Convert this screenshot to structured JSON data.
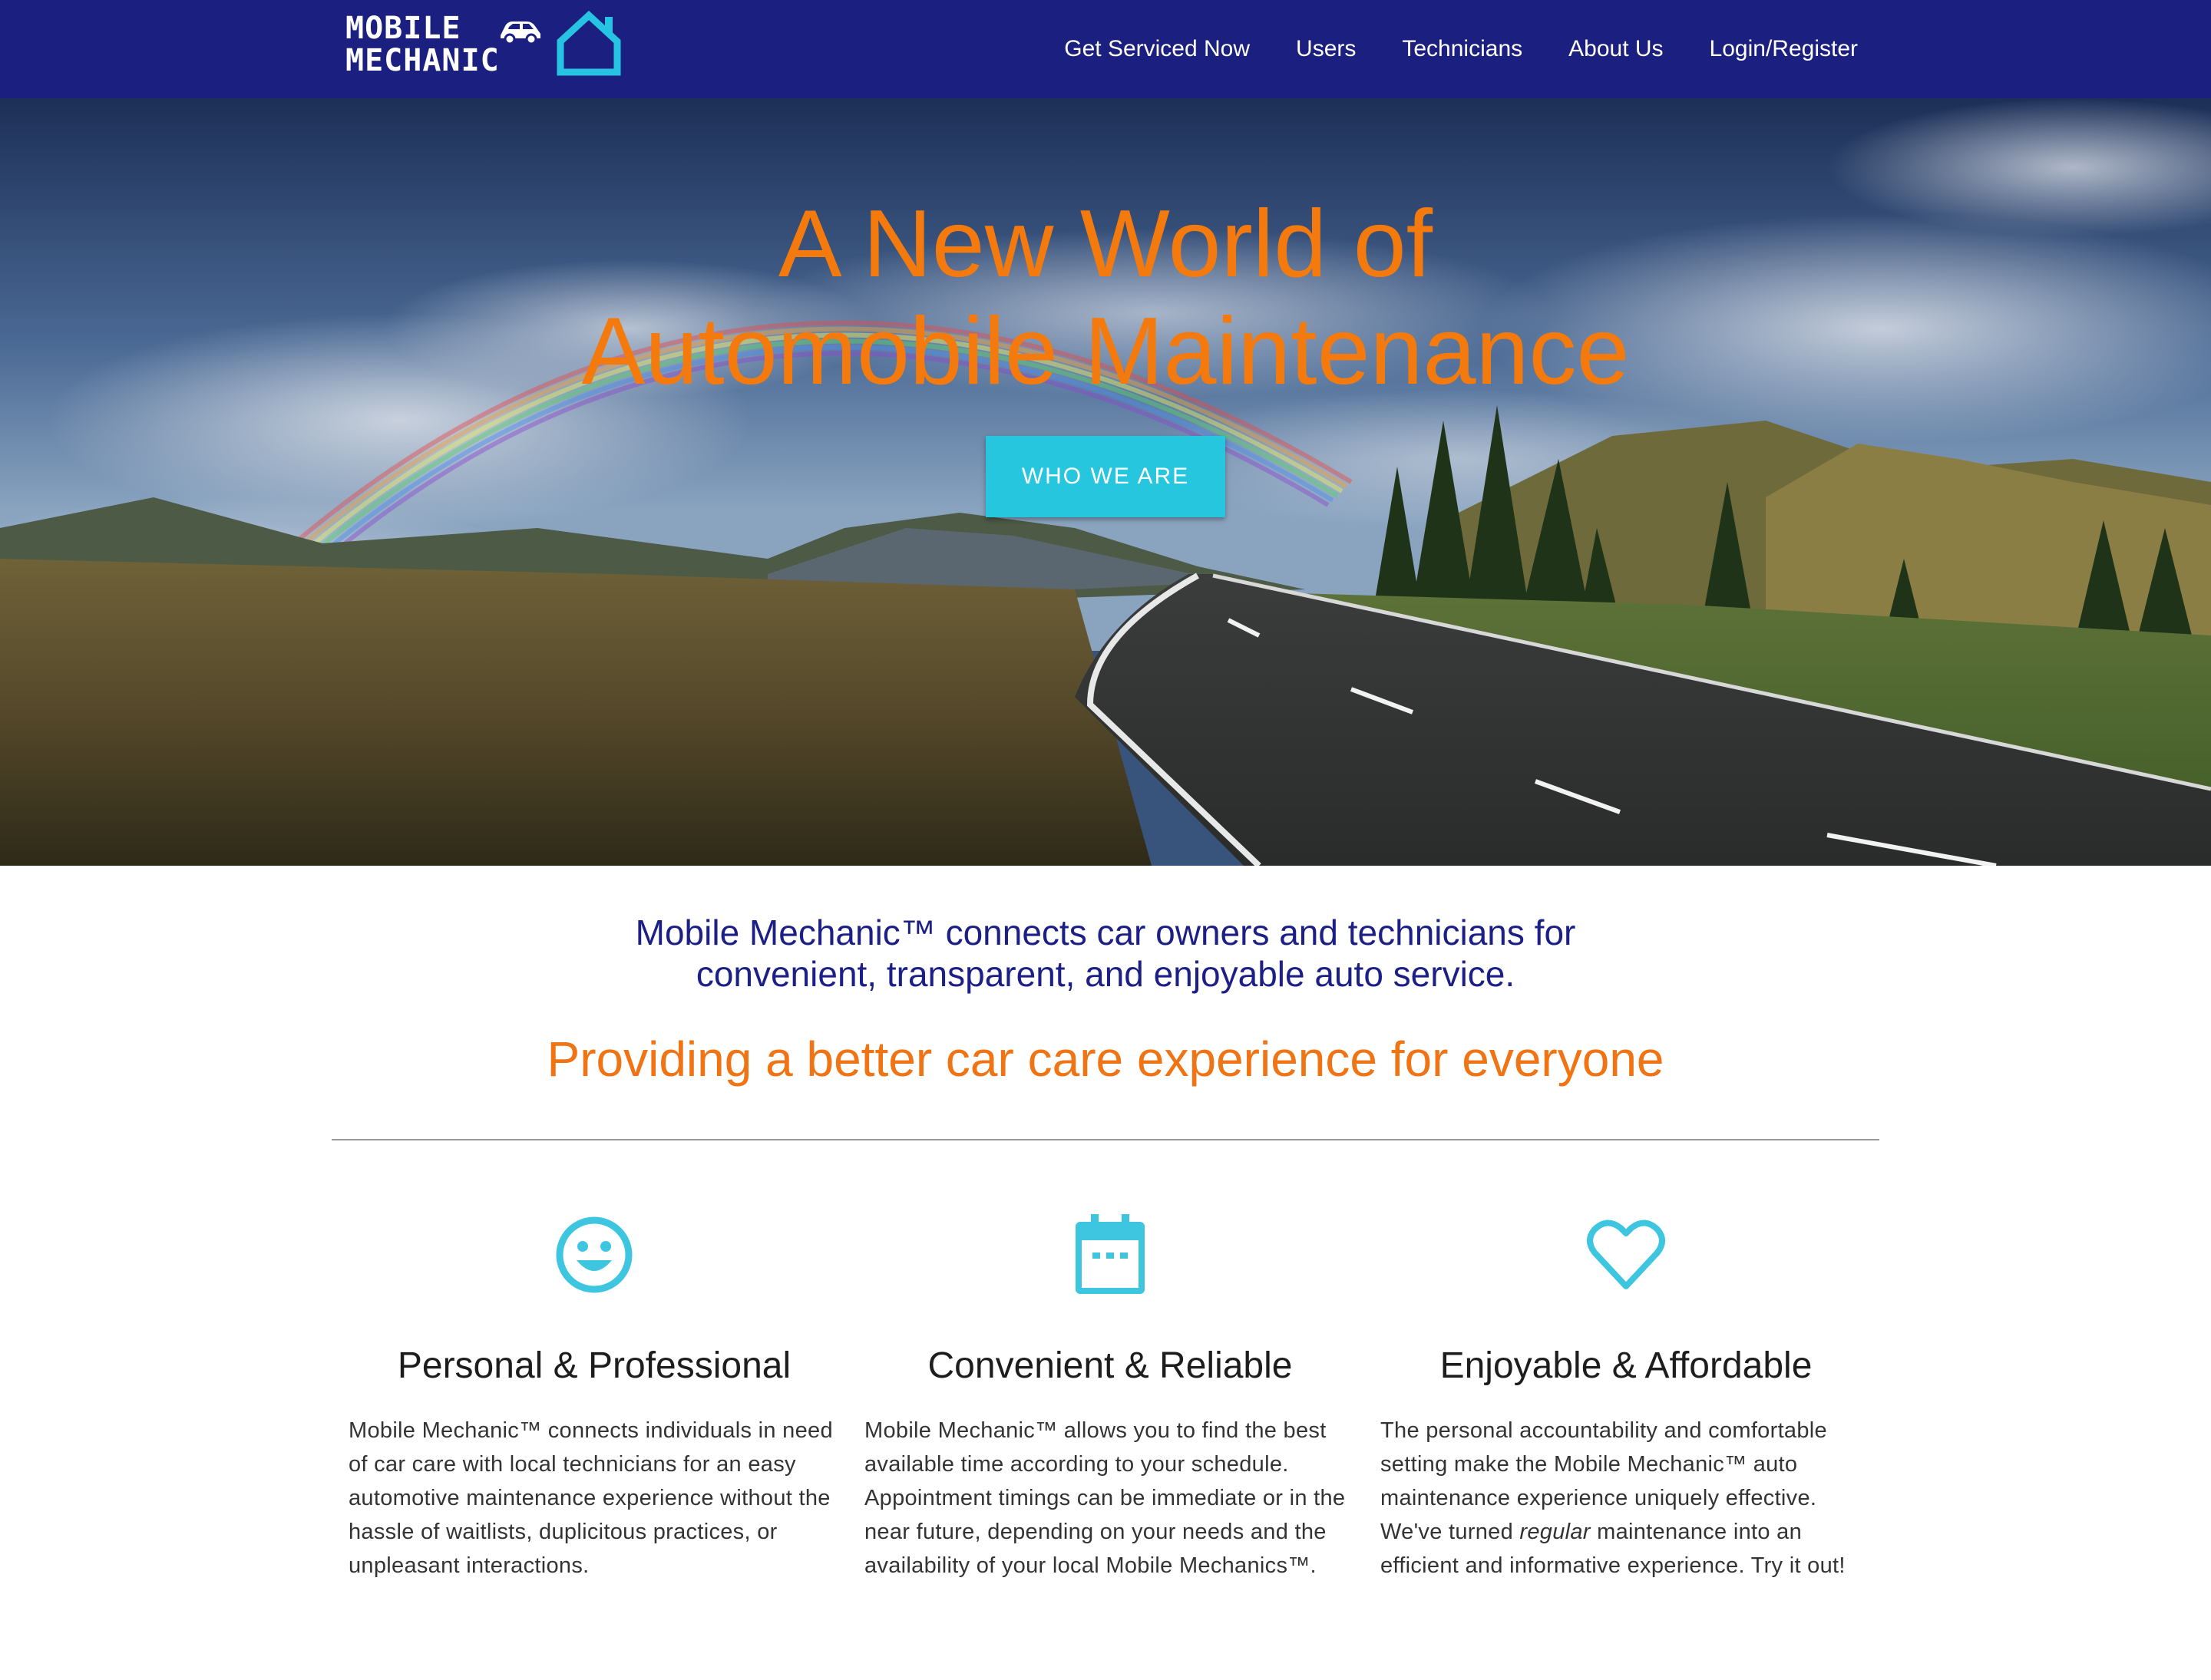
{
  "navbar": {
    "logo": {
      "line1": "MOBILE",
      "line2": "MECHANIC"
    },
    "links": [
      "Get Serviced Now",
      "Users",
      "Technicians",
      "About Us",
      "Login/Register"
    ]
  },
  "hero": {
    "title_line1": "A New World of",
    "title_line2": "Automobile Maintenance",
    "button_label": "WHO WE ARE"
  },
  "intro": {
    "line1": "Mobile Mechanic™ connects car owners and technicians for",
    "line2": "convenient, transparent, and enjoyable auto service."
  },
  "tagline": "Providing a better car care experience for everyone",
  "features": [
    {
      "icon": "smiley-icon",
      "title": "Personal & Professional",
      "text": "Mobile Mechanic™ connects individuals in need of car care with local technicians for an easy automotive maintenance experience without the hassle of waitlists, duplicitous practices, or unpleasant interactions."
    },
    {
      "icon": "calendar-icon",
      "title": "Convenient & Reliable",
      "text": "Mobile Mechanic™ allows you to find the best available time according to your schedule. Appointment timings can be immediate or in the near future, depending on your needs and the availability of your local Mobile Mechanics™."
    },
    {
      "icon": "heart-icon",
      "title": "Enjoyable & Affordable",
      "text_before": "The personal accountability and comfortable setting make the Mobile Mechanic™ auto maintenance experience uniquely effective. We've turned ",
      "text_emphasis": "regular",
      "text_after": " maintenance into an efficient and informative experience. Try it out!"
    }
  ],
  "colors": {
    "navbar": "#1b2080",
    "accent_orange": "#f47a0d",
    "accent_cyan": "#25c6de",
    "intro_blue": "#1b1f86"
  }
}
